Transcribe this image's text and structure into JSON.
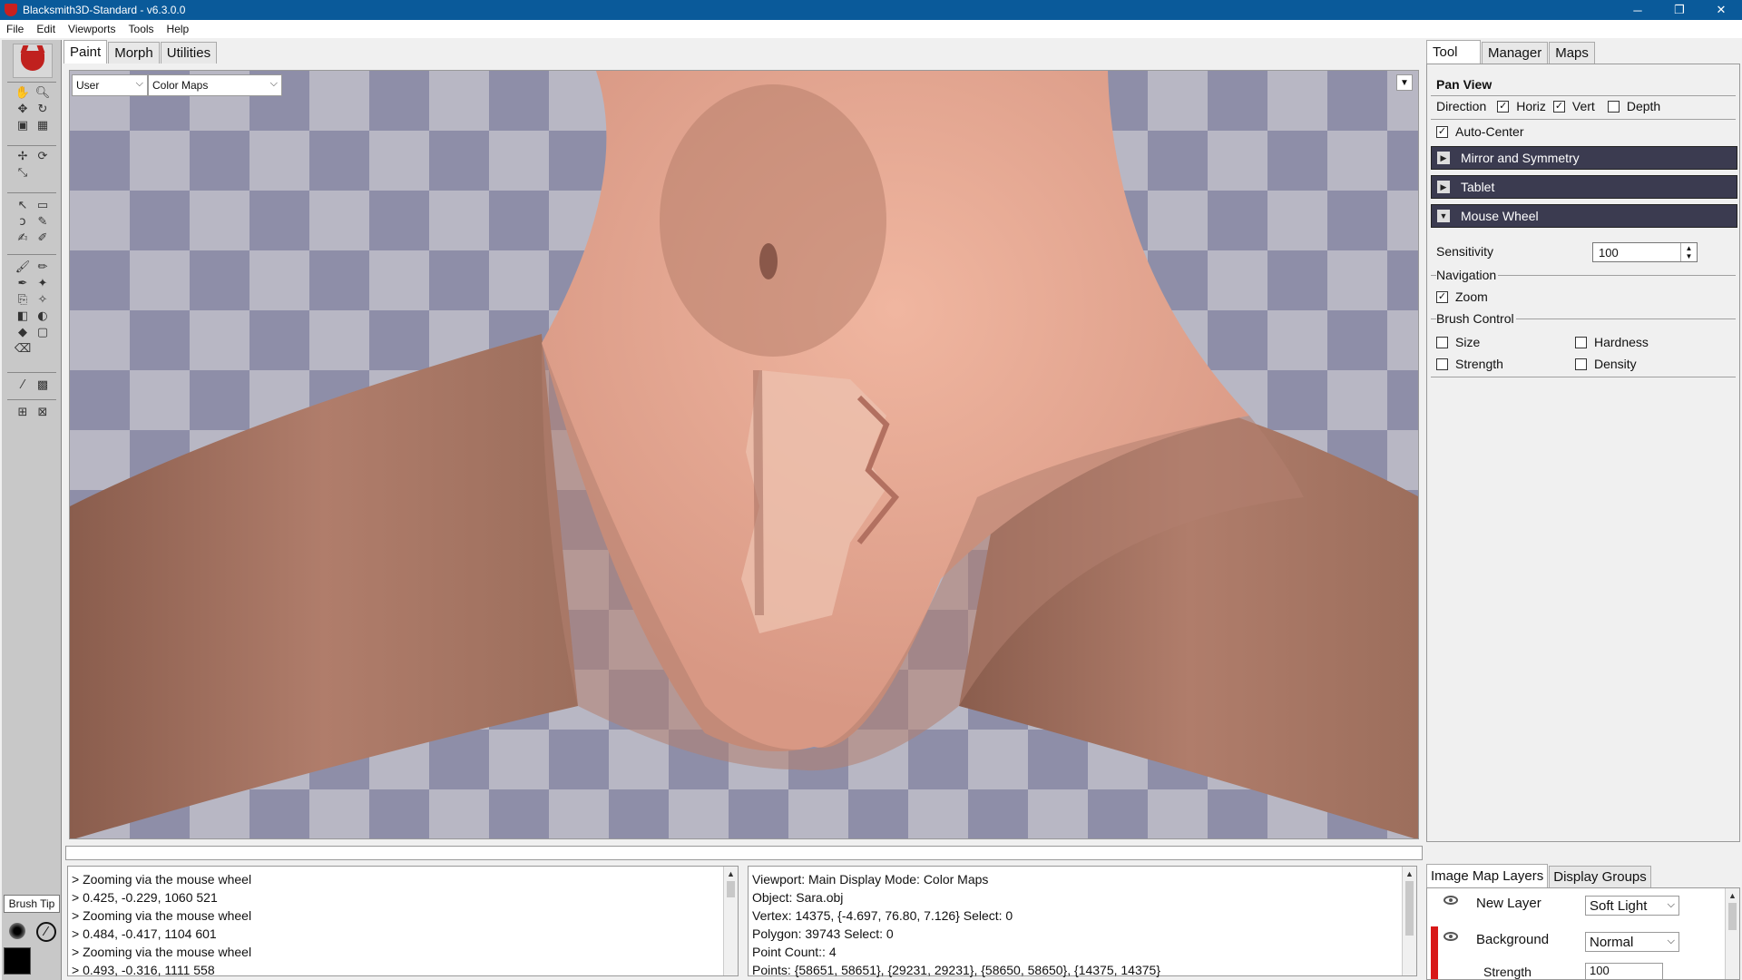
{
  "window": {
    "title": "Blacksmith3D-Standard - v6.3.0.0",
    "controls": {
      "minimize": "─",
      "restore": "❐",
      "close": "✕"
    }
  },
  "menu": [
    "File",
    "Edit",
    "Viewports",
    "Tools",
    "Help"
  ],
  "left_tabs": [
    "Paint",
    "Morph",
    "Utilities"
  ],
  "viewport": {
    "camera_select": "User",
    "display_select": "Color Maps"
  },
  "brush_tip_label": "Brush Tip",
  "console_lines": [
    "> Zooming via the mouse wheel",
    "> 0.425, -0.229, 1060 521",
    "> Zooming via the mouse wheel",
    "> 0.484, -0.417, 1104 601",
    "> Zooming via the mouse wheel",
    "> 0.493, -0.316, 1111 558"
  ],
  "info_lines": [
    "Viewport: Main Display Mode: Color Maps",
    "Object: Sara.obj",
    "Vertex: 14375, {-4.697, 76.80, 7.126}    Select: 0",
    "Polygon: 39743    Select: 0",
    "   Point Count:: 4",
    "   Points:  {58651, 58651},  {29231, 29231},  {58650, 58650},  {14375, 14375}"
  ],
  "right_tabs": [
    "Tool",
    "Manager",
    "Maps"
  ],
  "tool_panel": {
    "title": "Pan View",
    "direction_label": "Direction",
    "horiz_label": "Horiz",
    "vert_label": "Vert",
    "depth_label": "Depth",
    "auto_center_label": "Auto-Center",
    "sections": [
      "Mirror and Symmetry",
      "Tablet",
      "Mouse Wheel"
    ],
    "sensitivity_label": "Sensitivity",
    "sensitivity_value": "100",
    "navigation_label": "Navigation",
    "zoom_label": "Zoom",
    "brush_control_label": "Brush Control",
    "size_label": "Size",
    "hardness_label": "Hardness",
    "strength_label": "Strength",
    "density_label": "Density"
  },
  "checks": {
    "horiz": true,
    "vert": true,
    "depth": false,
    "auto_center": true,
    "zoom": true,
    "size": false,
    "hardness": false,
    "strength": false,
    "density": false
  },
  "layer_tabs": [
    "Image Map Layers",
    "Display Groups"
  ],
  "layers": [
    {
      "name": "New Layer",
      "blend": "Soft Light"
    },
    {
      "name": "Background",
      "blend": "Normal",
      "strength_label": "Strength",
      "strength_value": "100"
    }
  ],
  "icons": {
    "dropdown": "⌵",
    "check": "✓",
    "section_collapsed": "▶",
    "section_expanded": "▼"
  },
  "colors": {
    "titlebar": "#0a5a9a",
    "section_header": "#3b3b50",
    "checker_dark": "#8e8ea8",
    "checker_light": "#b8b7c4",
    "skin": "#c08268",
    "layer_marker": "#d81818"
  }
}
